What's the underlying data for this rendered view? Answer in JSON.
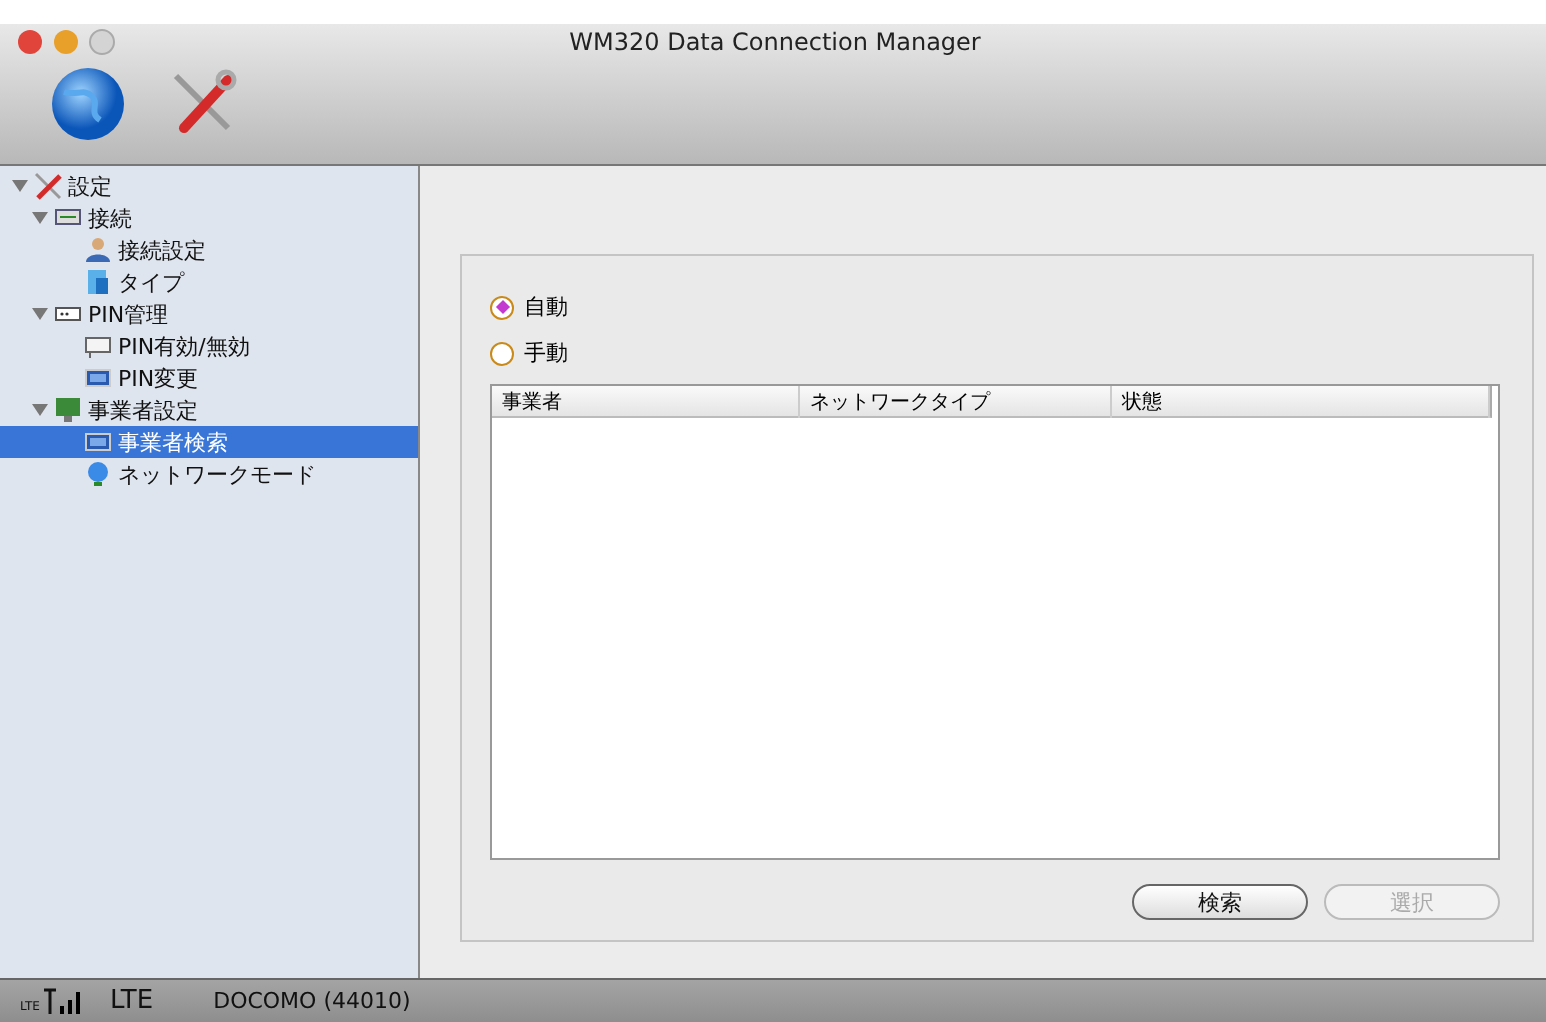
{
  "window": {
    "title": "WM320 Data Connection Manager"
  },
  "sidebar": {
    "tree": [
      {
        "label": "設定",
        "kind": "tools",
        "expanded": true,
        "selected": false,
        "children": [
          {
            "label": "接続",
            "kind": "port",
            "expanded": true,
            "selected": false,
            "children": [
              {
                "label": "接続設定",
                "kind": "person",
                "selected": false
              },
              {
                "label": "タイプ",
                "kind": "doc",
                "selected": false
              }
            ]
          },
          {
            "label": "PIN管理",
            "kind": "pin",
            "expanded": true,
            "selected": false,
            "children": [
              {
                "label": "PIN有効/無効",
                "kind": "panel",
                "selected": false
              },
              {
                "label": "PIN変更",
                "kind": "screen",
                "selected": false
              }
            ]
          },
          {
            "label": "事業者設定",
            "kind": "monitor",
            "expanded": true,
            "selected": false,
            "children": [
              {
                "label": "事業者検索",
                "kind": "screen",
                "selected": true
              },
              {
                "label": "ネットワークモード",
                "kind": "globe",
                "selected": false
              }
            ]
          }
        ]
      }
    ]
  },
  "content": {
    "mode_options": [
      {
        "label": "自動",
        "selected": true
      },
      {
        "label": "手動",
        "selected": false
      }
    ],
    "table": {
      "columns": [
        "事業者",
        "ネットワークタイプ",
        "状態"
      ]
    },
    "buttons": [
      {
        "label": "検索",
        "disabled": false
      },
      {
        "label": "選択",
        "disabled": true
      }
    ]
  },
  "status_bar": {
    "signal_label": "LTE",
    "network": "LTE",
    "carrier": "DOCOMO (44010)"
  }
}
